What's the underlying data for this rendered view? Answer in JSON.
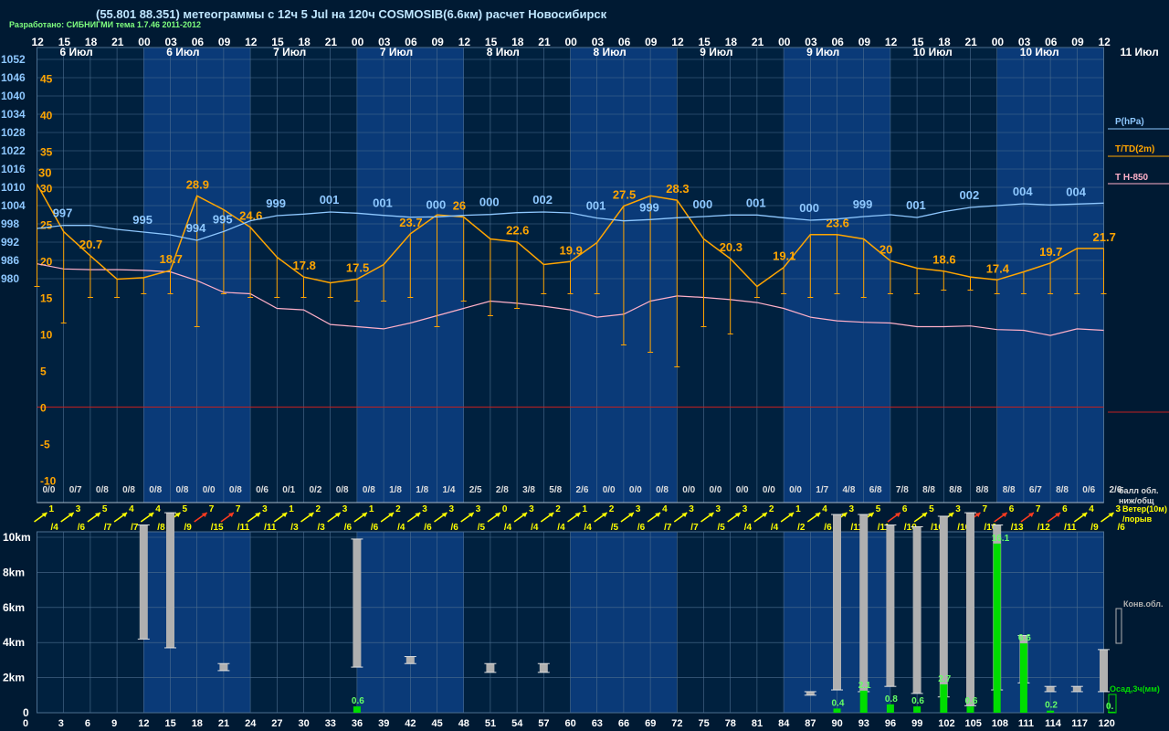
{
  "header": {
    "title": "(55.801 88.351) метеограммы с  12ч 5 Jul на 120ч COSMOSIB(6.6км) расчет Новосибирск",
    "credit": "Разработано: СИБНИГМИ тема 1.7.46 2011-2012"
  },
  "legend": {
    "pressure": "P(hPa)",
    "temperature": "T/TD(2m)",
    "t850": "T H-850",
    "cloud_cover": "балл обл.",
    "cloud_cover_sub": "ниж/общ",
    "wind": "Ветер(10м)",
    "wind_sub": "/порыв",
    "convective": "Конв.обл.",
    "precip": "Осад,3ч(мм)"
  },
  "colors": {
    "background": "#001a33",
    "band": "#0a3a78",
    "grid": "#4d6e8f",
    "pressure": "#8ec8ff",
    "temperature": "#ffa500",
    "t850": "#ffb0c8",
    "zero_line": "#c02020",
    "precip": "#00dd00",
    "cloud": "#b0b0b0",
    "wind_weak": "#ffff00",
    "wind_strong": "#ff3b1f"
  },
  "chart_data": {
    "type": "line",
    "hour_ticks_top": [
      "12",
      "15",
      "18",
      "21",
      "00",
      "03",
      "06",
      "09",
      "12",
      "15",
      "18",
      "21",
      "00",
      "03",
      "06",
      "09",
      "12",
      "15",
      "18",
      "21",
      "00",
      "03",
      "06",
      "09",
      "12",
      "15",
      "18",
      "21",
      "00",
      "03",
      "06",
      "09",
      "12",
      "15",
      "18",
      "21",
      "00",
      "03",
      "06",
      "09",
      "12"
    ],
    "day_labels": [
      "6 Июл",
      "6 Июл",
      "7 Июл",
      "7 Июл",
      "8 Июл",
      "8 Июл",
      "9 Июл",
      "9 Июл",
      "10 Июл",
      "10 Июл",
      "11 Июл"
    ],
    "hour_ticks_bottom": [
      "0",
      "3",
      "6",
      "9",
      "12",
      "15",
      "18",
      "21",
      "24",
      "27",
      "30",
      "33",
      "36",
      "39",
      "42",
      "45",
      "48",
      "51",
      "54",
      "57",
      "60",
      "63",
      "66",
      "69",
      "72",
      "75",
      "78",
      "81",
      "84",
      "87",
      "90",
      "93",
      "96",
      "99",
      "102",
      "105",
      "108",
      "111",
      "114",
      "117",
      "120"
    ],
    "pressure_axis": [
      "1052",
      "1046",
      "1040",
      "1034",
      "1028",
      "1022",
      "1016",
      "1010",
      "1004",
      "998",
      "992",
      "986",
      "980"
    ],
    "temperature_axis": [
      "45",
      "40",
      "35",
      "30",
      "25",
      "20",
      "15",
      "10",
      "5",
      "0",
      "-5",
      "-10"
    ],
    "height_axis": [
      "10km",
      "8km",
      "6km",
      "4km",
      "2km",
      "0"
    ],
    "pressure": {
      "name": "P(hPa)",
      "values": [
        996.5,
        997.5,
        997.5,
        996.2,
        995.3,
        994.4,
        992.6,
        995.5,
        999.0,
        1000.7,
        1001.2,
        1001.9,
        1001.5,
        1000.8,
        1000.2,
        1000.3,
        1000.8,
        1001.1,
        1001.7,
        1001.9,
        1001.6,
        999.9,
        999.0,
        999.4,
        1000.0,
        1000.4,
        1000.9,
        1000.9,
        1000.0,
        999.2,
        999.6,
        1000.4,
        1001.0,
        1000.1,
        1002.0,
        1003.4,
        1004.0,
        1004.6,
        1004.2,
        1004.5,
        1004.8
      ],
      "labels": [
        {
          "i": 1,
          "text": "997"
        },
        {
          "i": 4,
          "text": "995"
        },
        {
          "i": 6,
          "text": "994"
        },
        {
          "i": 7,
          "text": "995"
        },
        {
          "i": 9,
          "text": "999"
        },
        {
          "i": 11,
          "text": "001"
        },
        {
          "i": 13,
          "text": "001"
        },
        {
          "i": 15,
          "text": "000"
        },
        {
          "i": 17,
          "text": "000"
        },
        {
          "i": 19,
          "text": "002"
        },
        {
          "i": 21,
          "text": "001"
        },
        {
          "i": 23,
          "text": "999"
        },
        {
          "i": 25,
          "text": "000"
        },
        {
          "i": 27,
          "text": "001"
        },
        {
          "i": 29,
          "text": "000"
        },
        {
          "i": 31,
          "text": "999"
        },
        {
          "i": 33,
          "text": "001"
        },
        {
          "i": 35,
          "text": "002"
        },
        {
          "i": 37,
          "text": "004"
        },
        {
          "i": 39,
          "text": "004"
        }
      ]
    },
    "temperature": {
      "name": "T/TD(2m)",
      "values": [
        30.5,
        24.0,
        20.7,
        17.5,
        17.7,
        18.7,
        28.9,
        27.0,
        24.6,
        20.5,
        17.8,
        17.0,
        17.5,
        19.5,
        23.7,
        26.3,
        26.0,
        23.0,
        22.6,
        19.5,
        19.9,
        22.5,
        27.5,
        28.9,
        28.3,
        23.0,
        20.3,
        16.5,
        19.1,
        23.6,
        23.6,
        23.0,
        20.0,
        19.0,
        18.6,
        17.8,
        17.4,
        18.5,
        19.7,
        21.7,
        21.7
      ],
      "dew_point": [
        16.5,
        11.5,
        15.0,
        15.0,
        15.5,
        15.5,
        11.0,
        15.5,
        15.0,
        15.0,
        15.0,
        15.0,
        14.5,
        14.5,
        15.0,
        11.0,
        14.5,
        12.5,
        13.5,
        15.5,
        15.5,
        15.5,
        8.5,
        7.5,
        5.5,
        11.0,
        10.0,
        15.0,
        15.5,
        15.0,
        15.5,
        15.0,
        15.5,
        15.5,
        16.0,
        16.0,
        15.5,
        15.5,
        15.5,
        15.5,
        15.5
      ],
      "labels": [
        {
          "i": 0,
          "text": "30"
        },
        {
          "i": 2,
          "text": "20.7"
        },
        {
          "i": 5,
          "text": "18.7"
        },
        {
          "i": 6,
          "text": "28.9"
        },
        {
          "i": 8,
          "text": "24.6"
        },
        {
          "i": 10,
          "text": "17.8"
        },
        {
          "i": 12,
          "text": "17.5"
        },
        {
          "i": 14,
          "text": "23.7"
        },
        {
          "i": 16,
          "text": "26"
        },
        {
          "i": 18,
          "text": "22.6"
        },
        {
          "i": 20,
          "text": "19.9"
        },
        {
          "i": 22,
          "text": "27.5"
        },
        {
          "i": 24,
          "text": "28.3"
        },
        {
          "i": 26,
          "text": "20.3"
        },
        {
          "i": 28,
          "text": "19.1"
        },
        {
          "i": 30,
          "text": "23.6"
        },
        {
          "i": 32,
          "text": "20"
        },
        {
          "i": 34,
          "text": "18.6"
        },
        {
          "i": 36,
          "text": "17.4"
        },
        {
          "i": 38,
          "text": "19.7"
        },
        {
          "i": 40,
          "text": "21.7"
        }
      ]
    },
    "t850": {
      "name": "T H-850",
      "values": [
        19.6,
        18.9,
        18.8,
        18.8,
        18.7,
        18.5,
        17.3,
        15.7,
        15.5,
        13.5,
        13.3,
        11.3,
        11.0,
        10.7,
        11.5,
        12.5,
        13.5,
        14.5,
        14.2,
        13.8,
        13.3,
        12.3,
        12.7,
        14.5,
        15.2,
        15.0,
        14.7,
        14.3,
        13.5,
        12.3,
        11.8,
        11.6,
        11.5,
        11.0,
        11.0,
        11.1,
        10.6,
        10.5,
        9.8,
        10.7,
        10.5
      ]
    },
    "cloud_cover": [
      "0/0",
      "0/7",
      "0/8",
      "0/8",
      "0/8",
      "0/8",
      "0/0",
      "0/8",
      "0/6",
      "0/1",
      "0/2",
      "0/8",
      "0/8",
      "1/8",
      "1/8",
      "1/4",
      "2/5",
      "2/8",
      "3/8",
      "5/8",
      "2/6",
      "0/0",
      "0/0",
      "0/8",
      "0/0",
      "0/0",
      "0/0",
      "0/0",
      "0/0",
      "1/7",
      "4/8",
      "6/8",
      "7/8",
      "8/8",
      "8/8",
      "8/8",
      "8/8",
      "6/7",
      "8/8",
      "0/6",
      "2/6"
    ],
    "wind": [
      {
        "s": "1",
        "g": "/4"
      },
      {
        "s": "3",
        "g": "/6"
      },
      {
        "s": "5",
        "g": "/7"
      },
      {
        "s": "4",
        "g": "/7"
      },
      {
        "s": "4",
        "g": "/8"
      },
      {
        "s": "5",
        "g": "/9"
      },
      {
        "s": "7",
        "g": "/15"
      },
      {
        "s": "7",
        "g": "/11"
      },
      {
        "s": "3",
        "g": "/11"
      },
      {
        "s": "1",
        "g": "/3"
      },
      {
        "s": "2",
        "g": "/3"
      },
      {
        "s": "3",
        "g": "/6"
      },
      {
        "s": "1",
        "g": "/6"
      },
      {
        "s": "2",
        "g": "/4"
      },
      {
        "s": "3",
        "g": "/6"
      },
      {
        "s": "3",
        "g": "/6"
      },
      {
        "s": "3",
        "g": "/5"
      },
      {
        "s": "0",
        "g": "/4"
      },
      {
        "s": "3",
        "g": "/4"
      },
      {
        "s": "2",
        "g": "/4"
      },
      {
        "s": "1",
        "g": "/4"
      },
      {
        "s": "2",
        "g": "/5"
      },
      {
        "s": "3",
        "g": "/6"
      },
      {
        "s": "4",
        "g": "/7"
      },
      {
        "s": "3",
        "g": "/7"
      },
      {
        "s": "3",
        "g": "/5"
      },
      {
        "s": "3",
        "g": "/4"
      },
      {
        "s": "2",
        "g": "/4"
      },
      {
        "s": "1",
        "g": "/2"
      },
      {
        "s": "4",
        "g": "/6"
      },
      {
        "s": "3",
        "g": "/11"
      },
      {
        "s": "5",
        "g": "/11"
      },
      {
        "s": "6",
        "g": "/10"
      },
      {
        "s": "5",
        "g": "/10"
      },
      {
        "s": "3",
        "g": "/10"
      },
      {
        "s": "7",
        "g": "/10"
      },
      {
        "s": "6",
        "g": "/13"
      },
      {
        "s": "7",
        "g": "/12"
      },
      {
        "s": "6",
        "g": "/11"
      },
      {
        "s": "4",
        "g": "/9"
      },
      {
        "s": "3",
        "g": "/6"
      }
    ],
    "wind_strong": [
      6,
      7,
      32,
      35,
      36,
      37,
      38
    ],
    "convective_clouds_km": [
      {
        "i": 4,
        "base": 4.2,
        "top": 10.7
      },
      {
        "i": 5,
        "base": 3.7,
        "top": 11.4
      },
      {
        "i": 7,
        "base": 2.4,
        "top": 2.8
      },
      {
        "i": 12,
        "base": 2.6,
        "top": 9.9
      },
      {
        "i": 14,
        "base": 2.8,
        "top": 3.2
      },
      {
        "i": 17,
        "base": 2.3,
        "top": 2.8
      },
      {
        "i": 19,
        "base": 2.3,
        "top": 2.8
      },
      {
        "i": 29,
        "base": 1.0,
        "top": 1.2
      },
      {
        "i": 30,
        "base": 1.3,
        "top": 11.3
      },
      {
        "i": 31,
        "base": 1.2,
        "top": 11.3
      },
      {
        "i": 32,
        "base": 1.5,
        "top": 10.7
      },
      {
        "i": 33,
        "base": 1.1,
        "top": 10.6
      },
      {
        "i": 34,
        "base": 0.9,
        "top": 11.2
      },
      {
        "i": 35,
        "base": 0.4,
        "top": 11.4
      },
      {
        "i": 36,
        "base": 1.3,
        "top": 10.7
      },
      {
        "i": 37,
        "base": 1.7,
        "top": 4.4
      },
      {
        "i": 38,
        "base": 1.2,
        "top": 1.5
      },
      {
        "i": 39,
        "base": 1.2,
        "top": 1.5
      },
      {
        "i": 40,
        "base": 1.2,
        "top": 3.6
      }
    ],
    "precip_mm": [
      {
        "i": 12,
        "v": 0.6,
        "label": "0.6"
      },
      {
        "i": 30,
        "v": 0.4,
        "label": "0.4"
      },
      {
        "i": 31,
        "v": 2.1,
        "label": "2.1"
      },
      {
        "i": 32,
        "v": 0.8,
        "label": "0.8"
      },
      {
        "i": 33,
        "v": 0.6,
        "label": "0.6"
      },
      {
        "i": 34,
        "v": 2.7,
        "label": "2.7"
      },
      {
        "i": 35,
        "v": 0.6,
        "label": "0.6"
      },
      {
        "i": 36,
        "v": 16.1,
        "label": "16.1"
      },
      {
        "i": 37,
        "v": 6.6,
        "label": "6.6"
      },
      {
        "i": 38,
        "v": 0.2,
        "label": "0.2"
      },
      {
        "i": 41,
        "v": 0.1,
        "label": "0."
      }
    ]
  }
}
